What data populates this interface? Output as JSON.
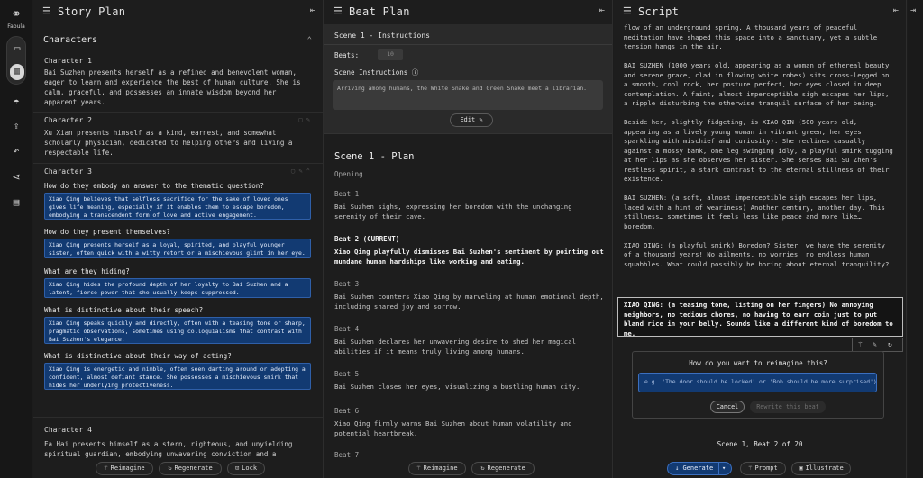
{
  "app": {
    "name": "Fabula"
  },
  "rail": {
    "icons": [
      "fabula-logo-icon",
      "layers-icon",
      "columns-icon",
      "umbrella-icon",
      "import-icon",
      "undo-icon",
      "share-icon",
      "document-icon"
    ]
  },
  "story_plan": {
    "title": "Story Plan",
    "characters_heading": "Characters",
    "characters": [
      {
        "label": "Character 1",
        "desc": "Bai Suzhen presents herself as a refined and benevolent woman, eager to learn and experience the best of human culture. She is calm, graceful, and possesses an innate wisdom beyond her apparent years."
      },
      {
        "label": "Character 2",
        "desc": "Xu Xian presents himself as a kind, earnest, and somewhat scholarly physician, dedicated to helping others and living a respectable life."
      },
      {
        "label": "Character 3"
      },
      {
        "label": "Character 4",
        "desc": "Fa Hai presents himself as a stern, righteous, and unyielding spiritual guardian, embodying unwavering conviction and a profound"
      }
    ],
    "qa": [
      {
        "q": "How do they embody an answer to the thematic question?",
        "a": "Xiao Qing believes that selfless sacrifice for the sake of loved ones gives life meaning, especially if it enables them to escape boredom, embodying a transcendent form of love and active engagement."
      },
      {
        "q": "How do they present themselves?",
        "a": "Xiao Qing presents herself as a loyal, spirited, and playful younger sister, often quick with a witty retort or a mischievous glint in her eye."
      },
      {
        "q": "What are they hiding?",
        "a": "Xiao Qing hides the profound depth of her loyalty to Bai Suzhen and a latent, fierce power that she usually keeps suppressed."
      },
      {
        "q": "What is distinctive about their speech?",
        "a": "Xiao Qing speaks quickly and directly, often with a teasing tone or sharp, pragmatic observations, sometimes using colloquialisms that contrast with Bai Suzhen's elegance."
      },
      {
        "q": "What is distinctive about their way of acting?",
        "a": "Xiao Qing is energetic and nimble, often seen darting around or adopting a confident, almost defiant stance. She possesses a mischievous smirk that hides her underlying protectiveness."
      }
    ],
    "buttons": {
      "reimagine": "Reimagine",
      "regenerate": "Regenerate",
      "lock": "Lock"
    }
  },
  "beat_plan": {
    "title": "Beat Plan",
    "instructions_title": "Scene 1 - Instructions",
    "beats_label": "Beats:",
    "beats_value": "10",
    "scene_instructions_label": "Scene Instructions",
    "scene_instructions": "Arriving among humans, the White Snake and Green Snake meet a librarian.",
    "edit_label": "Edit",
    "plan_title": "Scene 1 - Plan",
    "opening_label": "Opening",
    "beats": [
      {
        "label": "Beat 1",
        "text": "Bai Suzhen sighs, expressing her boredom with the unchanging serenity of their cave."
      },
      {
        "label": "Beat 2 (CURRENT)",
        "text": "Xiao Qing playfully dismisses Bai Suzhen's sentiment by pointing out mundane human hardships like working and eating."
      },
      {
        "label": "Beat 3",
        "text": "Bai Suzhen counters Xiao Qing by marveling at human emotional depth, including shared joy and sorrow."
      },
      {
        "label": "Beat 4",
        "text": "Bai Suzhen declares her unwavering desire to shed her magical abilities if it means truly living among humans."
      },
      {
        "label": "Beat 5",
        "text": "Bai Suzhen closes her eyes, visualizing a bustling human city."
      },
      {
        "label": "Beat 6",
        "text": "Xiao Qing firmly warns Bai Suzhen about human volatility and potential heartbreak."
      },
      {
        "label": "Beat 7",
        "text": ""
      }
    ],
    "buttons": {
      "reimagine": "Reimagine",
      "regenerate": "Regenerate"
    }
  },
  "script": {
    "title": "Script",
    "paragraphs": [
      "flow of an underground spring. A thousand years of peaceful meditation have shaped this space into a sanctuary, yet a subtle tension hangs in the air.",
      "BAI SUZHEN (1000 years old, appearing as a woman of ethereal beauty and serene grace, clad in flowing white robes) sits cross-legged on a smooth, cool rock, her posture perfect, her eyes closed in deep contemplation. A faint, almost imperceptible sigh escapes her lips, a ripple disturbing the otherwise tranquil surface of her being.",
      "Beside her, slightly fidgeting, is XIAO QIN (500 years old, appearing as a lively young woman in vibrant green, her eyes sparkling with mischief and curiosity). She reclines casually against a mossy bank, one leg swinging idly, a playful smirk tugging at her lips as she observes her sister. She senses Bai Su Zhen's restless spirit, a stark contrast to the eternal stillness of their existence.",
      "",
      "BAI SUZHEN: (a soft, almost imperceptible sigh escapes her lips, laced with a hint of weariness) Another century, another day. This stillness… sometimes it feels less like peace and more like… boredom.",
      "XIAO QING: (a playful smirk) Boredom? Sister, we have the serenity of a thousand years! No ailments, no worries, no endless human squabbles. What could possibly be boring about eternal tranquility?"
    ],
    "selected_text": "XIAO QING: (a teasing tone, listing on her fingers) No annoying neighbors, no tedious chores, no having to earn coin just to put bland rice in your belly. Sounds like a different kind of boredom to me.",
    "reimagine_question": "How do you want to reimagine this?",
    "reimagine_placeholder": "e.g. 'The door should be locked' or 'Bob should be more surprised')",
    "cancel_label": "Cancel",
    "rewrite_label": "Rewrite this beat",
    "status": "Scene 1, Beat 2 of 20",
    "buttons": {
      "generate": "Generate",
      "prompt": "Prompt",
      "illustrate": "Illustrate"
    }
  },
  "colors": {
    "accent_blue": "#123a72",
    "accent_border": "#3b6fbf",
    "background": "#1d1d1d"
  }
}
